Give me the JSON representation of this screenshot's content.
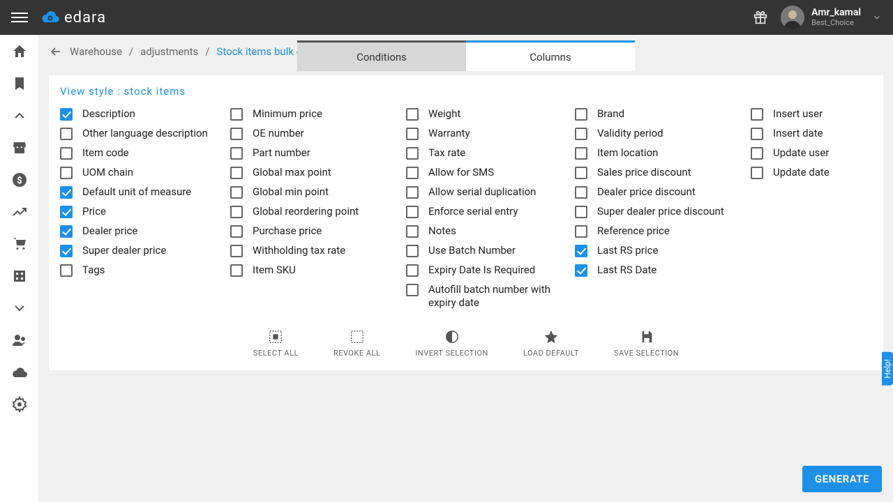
{
  "brand": "edara",
  "user": {
    "name": "Amr_kamal",
    "sub": "Best_Choice"
  },
  "breadcrumb": {
    "a": "Warehouse",
    "b": "adjustments",
    "c": "Stock items bulk edit"
  },
  "tabs": {
    "conditions": "Conditions",
    "columns": "Columns"
  },
  "view_style": "View style : stock items",
  "columns": {
    "c1": [
      {
        "label": "Description",
        "checked": true
      },
      {
        "label": "Other language description",
        "checked": false
      },
      {
        "label": "Item code",
        "checked": false
      },
      {
        "label": "UOM chain",
        "checked": false
      },
      {
        "label": "Default unit of measure",
        "checked": true
      },
      {
        "label": "Price",
        "checked": true
      },
      {
        "label": "Dealer price",
        "checked": true
      },
      {
        "label": "Super dealer price",
        "checked": true
      },
      {
        "label": "Tags",
        "checked": false
      }
    ],
    "c2": [
      {
        "label": "Minimum price",
        "checked": false
      },
      {
        "label": "OE number",
        "checked": false
      },
      {
        "label": "Part number",
        "checked": false
      },
      {
        "label": "Global max point",
        "checked": false
      },
      {
        "label": "Global min point",
        "checked": false
      },
      {
        "label": "Global reordering point",
        "checked": false
      },
      {
        "label": "Purchase price",
        "checked": false
      },
      {
        "label": "Withholding tax rate",
        "checked": false
      },
      {
        "label": "Item SKU",
        "checked": false
      }
    ],
    "c3": [
      {
        "label": "Weight",
        "checked": false
      },
      {
        "label": "Warranty",
        "checked": false
      },
      {
        "label": "Tax rate",
        "checked": false
      },
      {
        "label": "Allow for SMS",
        "checked": false
      },
      {
        "label": "Allow serial duplication",
        "checked": false
      },
      {
        "label": "Enforce serial entry",
        "checked": false
      },
      {
        "label": "Notes",
        "checked": false
      },
      {
        "label": "Use Batch Number",
        "checked": false
      },
      {
        "label": "Expiry Date Is Required",
        "checked": false
      },
      {
        "label": "Autofill batch number with expiry date",
        "checked": false
      }
    ],
    "c4": [
      {
        "label": "Brand",
        "checked": false
      },
      {
        "label": "Validity period",
        "checked": false
      },
      {
        "label": "Item location",
        "checked": false
      },
      {
        "label": "Sales price discount",
        "checked": false
      },
      {
        "label": "Dealer price discount",
        "checked": false
      },
      {
        "label": "Super dealer price discount",
        "checked": false
      },
      {
        "label": "Reference price",
        "checked": false
      },
      {
        "label": "Last RS price",
        "checked": true
      },
      {
        "label": "Last RS Date",
        "checked": true
      }
    ],
    "c5": [
      {
        "label": "Insert user",
        "checked": false
      },
      {
        "label": "Insert date",
        "checked": false
      },
      {
        "label": "Update user",
        "checked": false
      },
      {
        "label": "Update date",
        "checked": false
      }
    ]
  },
  "actions": {
    "select_all": "SELECT ALL",
    "revoke_all": "REVOKE ALL",
    "invert": "INVERT SELECTION",
    "load_default": "LOAD DEFAULT",
    "save": "SAVE SELECTION"
  },
  "generate": "GENERATE",
  "help": "Help!"
}
